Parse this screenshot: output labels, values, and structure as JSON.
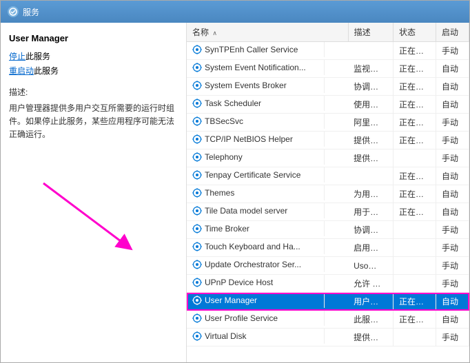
{
  "window": {
    "title": "服务",
    "title_icon": "⚙"
  },
  "left_panel": {
    "service_name": "User Manager",
    "stop_link": "停止",
    "stop_suffix": "此服务",
    "restart_link": "重启动",
    "restart_suffix": "此服务",
    "desc_label": "描述:",
    "desc_text": "用户管理器提供多用户交互所需要的运行时组件。如果停止此服务，某些应用程序可能无法正确运行。"
  },
  "table": {
    "columns": [
      "名称",
      "描述",
      "状态",
      "启动"
    ],
    "rows": [
      {
        "name": "SynTPEnh Caller Service",
        "desc": "",
        "status": "正在…",
        "startup": "手动"
      },
      {
        "name": "System Event Notification...",
        "desc": "监视…",
        "status": "正在…",
        "startup": "自动"
      },
      {
        "name": "System Events Broker",
        "desc": "协调…",
        "status": "正在…",
        "startup": "自动"
      },
      {
        "name": "Task Scheduler",
        "desc": "使用…",
        "status": "正在…",
        "startup": "自动"
      },
      {
        "name": "TBSecSvc",
        "desc": "阿里…",
        "status": "正在…",
        "startup": "手动"
      },
      {
        "name": "TCP/IP NetBIOS Helper",
        "desc": "提供…",
        "status": "正在…",
        "startup": "手动"
      },
      {
        "name": "Telephony",
        "desc": "提供…",
        "status": "",
        "startup": "手动"
      },
      {
        "name": "Tenpay Certificate Service",
        "desc": "",
        "status": "正在…",
        "startup": "自动"
      },
      {
        "name": "Themes",
        "desc": "为用…",
        "status": "正在…",
        "startup": "自动"
      },
      {
        "name": "Tile Data model server",
        "desc": "用于…",
        "status": "正在…",
        "startup": "自动"
      },
      {
        "name": "Time Broker",
        "desc": "协调…",
        "status": "",
        "startup": "手动"
      },
      {
        "name": "Touch Keyboard and Ha...",
        "desc": "启用…",
        "status": "",
        "startup": "手动"
      },
      {
        "name": "Update Orchestrator Ser...",
        "desc": "Uso…",
        "status": "",
        "startup": "手动"
      },
      {
        "name": "UPnP Device Host",
        "desc": "允许 …",
        "status": "",
        "startup": "手动"
      },
      {
        "name": "User Manager",
        "desc": "用户…",
        "status": "正在…",
        "startup": "自动",
        "selected": true
      },
      {
        "name": "User Profile Service",
        "desc": "此服…",
        "status": "正在…",
        "startup": "自动"
      },
      {
        "name": "Virtual Disk",
        "desc": "提供…",
        "status": "",
        "startup": "手动"
      }
    ]
  }
}
